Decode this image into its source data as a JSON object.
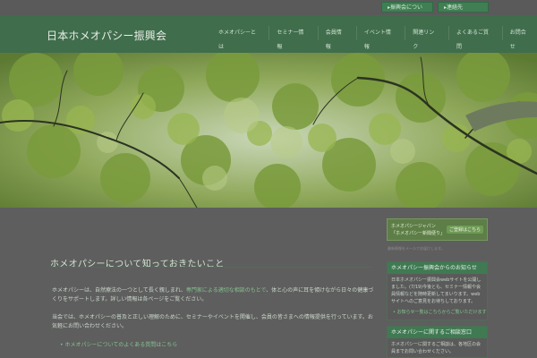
{
  "top_links": {
    "association": "▸振興会について",
    "contact": "▸連絡先"
  },
  "header": {
    "title": "日本ホメオパシー振興会"
  },
  "nav": {
    "items": [
      "ホメオパシーとは",
      "セミナー情報",
      "会員情報",
      "イベント情報",
      "関連リンク",
      "よくあるご質問",
      "お問合せ"
    ]
  },
  "main": {
    "heading": "ホメオパシーについて知っておきたいこと",
    "p1_start": "ホメオパシーは、自然療法の一つとして長く親しまれ、",
    "p1_highlight": "専門家による適切な相談のもとで",
    "p1_end": "、体と心の声に耳を傾けながら日々の健康づくりをサポートします。詳しい情報は各ページをご覧ください。",
    "p2": "当会では、ホメオパシーの普及と正しい理解のために、セミナーやイベントを開催し、会員の皆さまへの情報提供を行っています。お気軽にお問い合わせください。",
    "bullet": "ホメオパシーについてのよくある質問はこちら"
  },
  "sidebar": {
    "banner_top": "ホメオパシージャパン",
    "banner_bottom": "「ホメオパシー新聞便り」",
    "banner_btn": "ご登録はこちら",
    "banner_caption": "最新情報をメールでお届けします。",
    "box1_title": "ホメオパシー振興会からのお知らせ",
    "box1_body": "日本ホメオパシー振興会webサイトを公開しました。(7/19)今後とも、セミナー情報や会員情報などを随時更新してまいります。webサイトへのご意見をお待ちしております。",
    "box1_link": "お知らせ一覧はこちらからご覧いただけます",
    "box2_title": "ホメオパシーに関するご相談窓口",
    "box2_body": "ホメオパシーに関するご相談は、各地区の会員までお問い合わせください。"
  },
  "colors": {
    "accent": "#3f7f53",
    "link": "#86c08f",
    "header_bg": "#406d4c"
  }
}
